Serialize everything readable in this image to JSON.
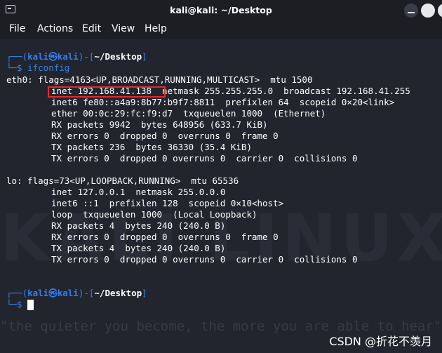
{
  "window": {
    "title": "kali@kali: ~/Desktop",
    "icons": [
      "terminal-icon",
      "minimize-icon",
      "maximize-icon",
      "close-icon"
    ]
  },
  "menubar": [
    "File",
    "Actions",
    "Edit",
    "View",
    "Help"
  ],
  "prompt": {
    "open": "┌──(",
    "user": "kali㉿kali",
    "mid": ")-[",
    "path": "~/Desktop",
    "close": "]",
    "lower": "└─$ "
  },
  "command": "ifconfig",
  "output": {
    "eth0_flags": "eth0: flags=4163<UP,BROADCAST,RUNNING,MULTICAST>  mtu 1500",
    "eth0_inet_a": "inet 192.168.41.138",
    "eth0_inet_b": "  netmask 255.255.255.0  broadcast 192.168.41.255",
    "eth0_inet6": "inet6 fe80::a4a9:8b77:b9f7:8811  prefixlen 64  scopeid 0×20<link>",
    "eth0_ether": "ether 00:0c:29:fc:f9:d7  txqueuelen 1000  (Ethernet)",
    "eth0_rxp": "RX packets 9942  bytes 648956 (633.7 KiB)",
    "eth0_rxe": "RX errors 0  dropped 0  overruns 0  frame 0",
    "eth0_txp": "TX packets 236  bytes 36330 (35.4 KiB)",
    "eth0_txe": "TX errors 0  dropped 0 overruns 0  carrier 0  collisions 0",
    "lo_flags": "lo: flags=73<UP,LOOPBACK,RUNNING>  mtu 65536",
    "lo_inet": "inet 127.0.0.1  netmask 255.0.0.0",
    "lo_inet6": "inet6 ::1  prefixlen 128  scopeid 0×10<host>",
    "lo_loop": "loop  txqueuelen 1000  (Local Loopback)",
    "lo_rxp": "RX packets 4  bytes 240 (240.0 B)",
    "lo_rxe": "RX errors 0  dropped 0  overruns 0  frame 0",
    "lo_txp": "TX packets 4  bytes 240 (240.0 B)",
    "lo_txe": "TX errors 0  dropped 0 overruns 0  carrier 0  collisions 0"
  },
  "background": {
    "watermark": "KALI LINUX",
    "quote": "\"the quieter you become, the more you are able to hear\""
  },
  "footer_watermark": "CSDN @折花不羡月",
  "colors": {
    "terminal_bg": "#23252e",
    "prompt_blue": "#3584e4",
    "highlight_red": "#e02a2a"
  }
}
